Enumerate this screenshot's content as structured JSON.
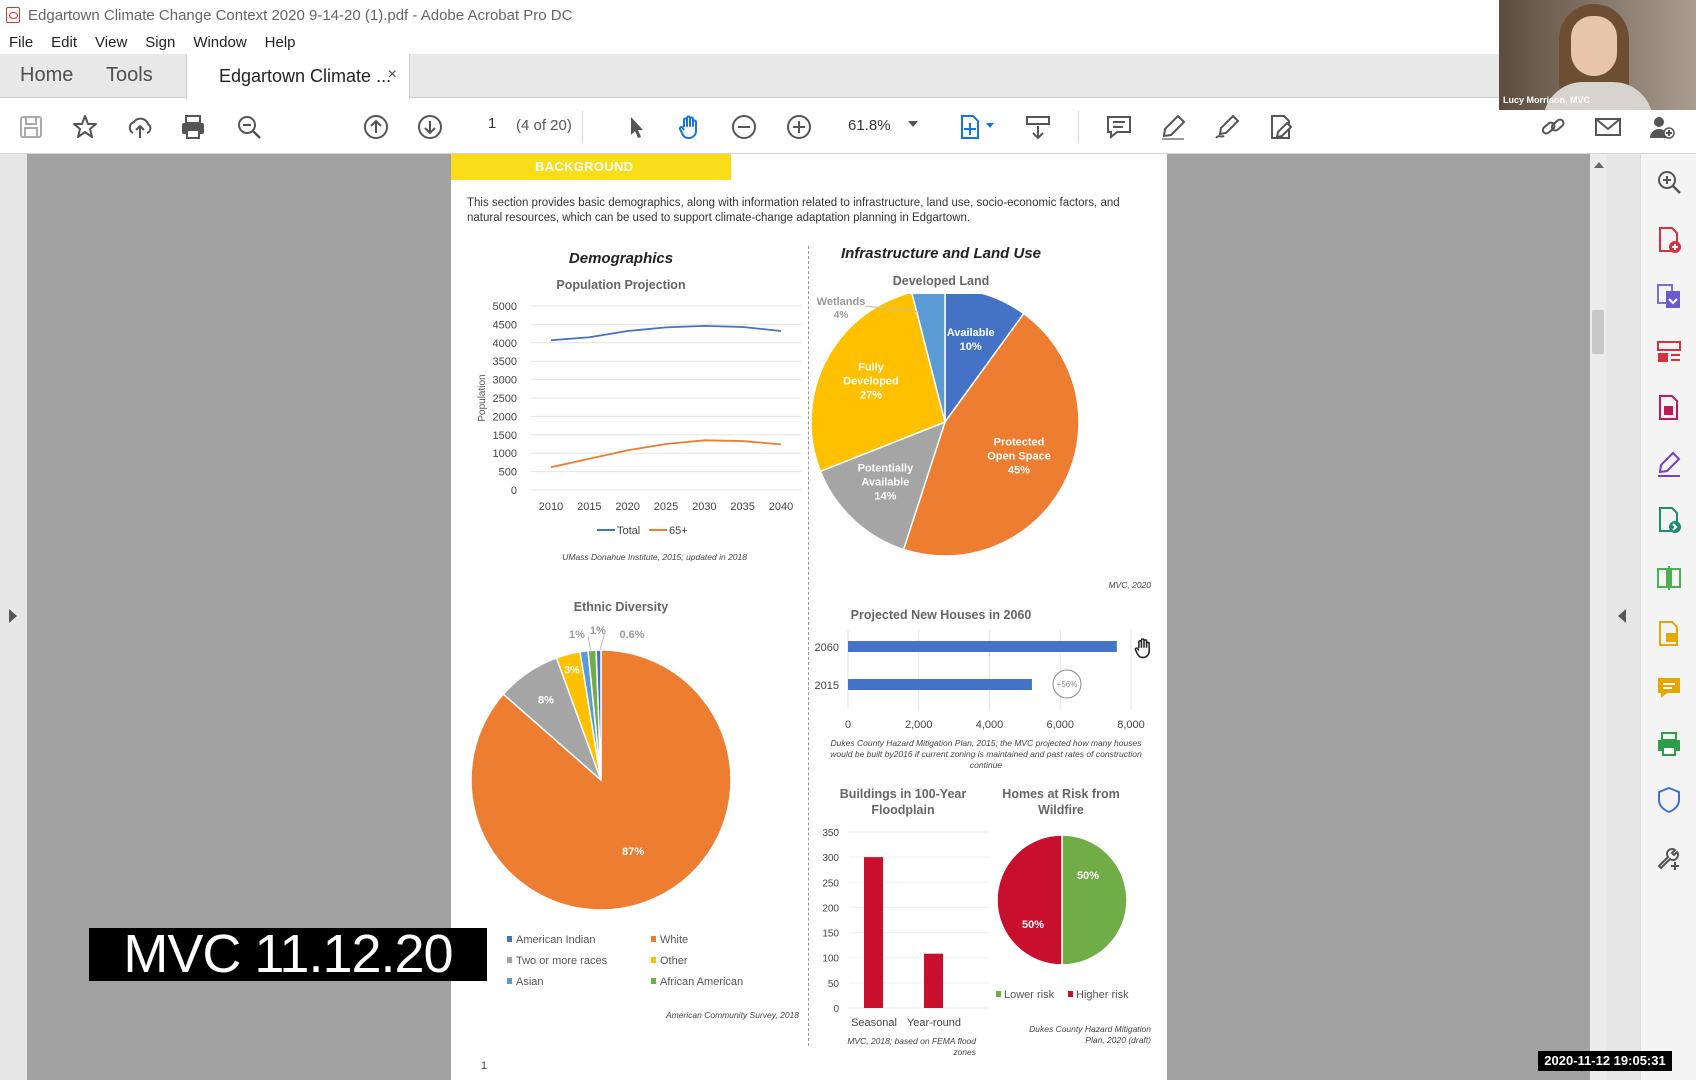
{
  "window": {
    "title": "Edgartown Climate Change Context 2020 9-14-20 (1).pdf - Adobe Acrobat Pro DC"
  },
  "menu": [
    "File",
    "Edit",
    "View",
    "Sign",
    "Window",
    "Help"
  ],
  "tabs": {
    "home": "Home",
    "tools": "Tools",
    "document": "Edgartown Climate ...",
    "close": "×"
  },
  "toolbar": {
    "page_number": "1",
    "page_of": "(4 of 20)",
    "zoom": "61.8%"
  },
  "video": {
    "participant_name": "Lucy Morrison, MVC"
  },
  "overlay": {
    "watermark": "MVC 11.12.20",
    "timestamp": "2020-11-12  19:05:31"
  },
  "page": {
    "banner": "BACKGROUND",
    "intro": "This section provides basic demographics, along with information related to infrastructure, land use, socio-economic factors, and natural resources, which can be used to support climate-change adaptation planning in Edgartown.",
    "left_section_title": "Demographics",
    "right_section_title": "Infrastructure and Land Use",
    "page_number": "1"
  },
  "colors": {
    "blue": "#4472c4",
    "orange": "#ed7d31",
    "gray": "#a5a5a5",
    "yellow": "#ffc000",
    "lightblue": "#5b9bd5",
    "green": "#70ad47",
    "red": "#c00000",
    "darkred": "#c8102e"
  },
  "chart_data": [
    {
      "type": "line",
      "title": "Population Projection",
      "ylabel": "Population",
      "x": [
        2010,
        2015,
        2020,
        2025,
        2030,
        2035,
        2040
      ],
      "ylim": [
        0,
        5000
      ],
      "yticks": [
        0,
        500,
        1000,
        1500,
        2000,
        2500,
        3000,
        3500,
        4000,
        4500,
        5000
      ],
      "series": [
        {
          "name": "Total",
          "values": [
            4070,
            4150,
            4320,
            4420,
            4460,
            4430,
            4320
          ]
        },
        {
          "name": "65+",
          "values": [
            620,
            850,
            1080,
            1250,
            1350,
            1330,
            1240
          ]
        }
      ],
      "source": "UMass Donahue Institute, 2015; updated in 2018"
    },
    {
      "type": "pie",
      "title": "Developed Land",
      "slices": [
        {
          "label": "Available",
          "value": 10
        },
        {
          "label": "Protected Open Space",
          "value": 45
        },
        {
          "label": "Potentially Available",
          "value": 14
        },
        {
          "label": "Fully Developed",
          "value": 27
        },
        {
          "label": "Wetlands",
          "value": 4
        }
      ],
      "source": "MVC, 2020"
    },
    {
      "type": "pie",
      "title": "Ethnic Diversity",
      "slices": [
        {
          "label": "White",
          "value": 87,
          "text": "87%"
        },
        {
          "label": "Two or more races",
          "value": 8,
          "text": "8%"
        },
        {
          "label": "Other",
          "value": 3,
          "text": "3%"
        },
        {
          "label": "Asian",
          "value": 1,
          "text": "1%"
        },
        {
          "label": "African American",
          "value": 1,
          "text": "1%"
        },
        {
          "label": "American Indian",
          "value": 0.6,
          "text": "0.6%"
        }
      ],
      "legend": [
        "American Indian",
        "White",
        "Two or more races",
        "Other",
        "Asian",
        "African American"
      ],
      "source": "American Community Survey, 2018"
    },
    {
      "type": "bar",
      "title": "Projected New Houses in 2060",
      "orientation": "horizontal",
      "categories": [
        "2060",
        "2015"
      ],
      "values": [
        7600,
        5200
      ],
      "xlim": [
        0,
        8000
      ],
      "xticks": [
        "0",
        "2,000",
        "4,000",
        "6,000",
        "8,000"
      ],
      "annotation": "+56%",
      "source": "Dukes County Hazard Mitigation Plan, 2015; the MVC projected how many houses would be built by2016 if current zoning is maintained and past rates of construction continue"
    },
    {
      "type": "bar",
      "title": "Buildings in 100-Year Floodplain",
      "categories": [
        "Seasonal",
        "Year-round"
      ],
      "values": [
        300,
        108
      ],
      "ylim": [
        0,
        350
      ],
      "yticks": [
        0,
        50,
        100,
        150,
        200,
        250,
        300,
        350
      ],
      "source": "MVC, 2018; based on FEMA flood zones"
    },
    {
      "type": "pie",
      "title": "Homes at Risk from Wildfire",
      "slices": [
        {
          "label": "Lower risk",
          "value": 50,
          "text": "50%"
        },
        {
          "label": "Higher risk",
          "value": 50,
          "text": "50%"
        }
      ],
      "source": "Dukes County Hazard Mitigation Plan, 2020 (draft)"
    }
  ]
}
